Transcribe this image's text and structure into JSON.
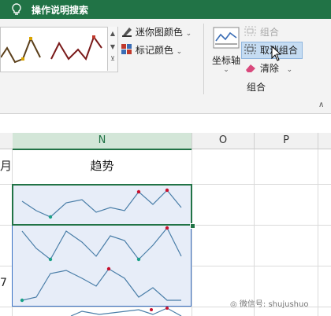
{
  "titlebar": {
    "tell_me": "操作说明搜索",
    "bulb_icon": "lightbulb-icon"
  },
  "ribbon": {
    "sparkline_color": "迷你图颜色",
    "marker_color": "标记颜色",
    "axis": "坐标轴",
    "group": "组合",
    "ungroup": "取消组合",
    "clear": "清除",
    "group_label": "组合"
  },
  "columns": {
    "n": "N",
    "o": "O",
    "p": "P"
  },
  "cells": {
    "row_label_partial": "月",
    "trend_header": "趋势",
    "row_num_partial": "7"
  },
  "watermark": "微信号: shujushuo",
  "colors": {
    "accent": "#217346",
    "line": "#4a7ea8",
    "high": "#c8102e",
    "low": "#1aa187",
    "selection": "#e7edf8"
  }
}
